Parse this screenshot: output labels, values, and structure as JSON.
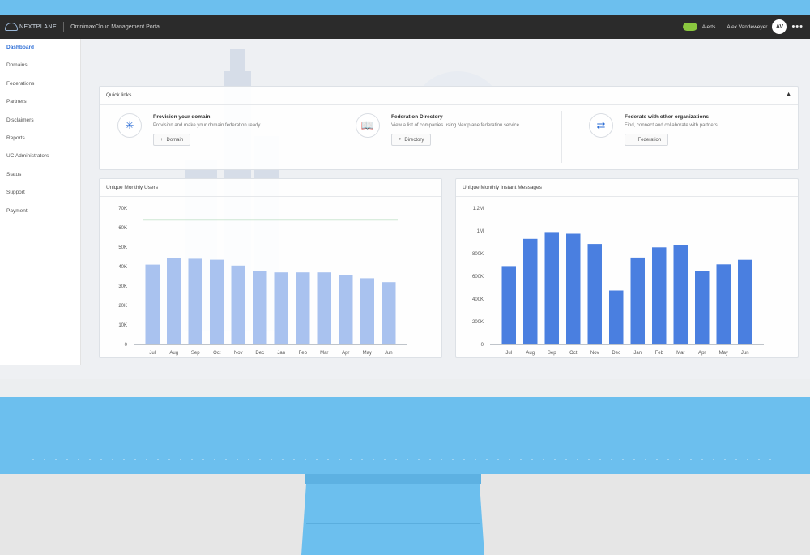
{
  "header": {
    "brand": "NEXTPLANE",
    "portal_title": "OmnimaxCloud Management Portal",
    "alerts_label": "Alerts",
    "user_name": "Alex Vandeweyer",
    "avatar_initials": "AV",
    "more_icon": "more-icon"
  },
  "sidebar": {
    "items": [
      {
        "label": "Dashboard",
        "active": true
      },
      {
        "label": "Domains"
      },
      {
        "label": "Federations"
      },
      {
        "label": "Partners"
      },
      {
        "label": "Disclaimers"
      },
      {
        "label": "Reports"
      },
      {
        "label": "UC Administrators"
      },
      {
        "label": "Status"
      },
      {
        "label": "Support"
      },
      {
        "label": "Payment"
      }
    ]
  },
  "quick_links": {
    "title": "Quick links",
    "items": [
      {
        "title": "Provision your domain",
        "desc": "Provision and make your domain federation ready.",
        "button": "Domain",
        "icon": "gear-cog-icon"
      },
      {
        "title": "Federation Directory",
        "desc": "View a list of companies using Nextplane federation service",
        "button": "Directory",
        "icon": "book-icon"
      },
      {
        "title": "Federate with other organizations",
        "desc": "Find, connect and collaborate with partners.",
        "button": "Federation",
        "icon": "swap-arrows-icon"
      }
    ]
  },
  "colors": {
    "accent": "#2f6fd6",
    "users_bar": "#a9c2ef",
    "msgs_bar": "#4a7fe0",
    "header_bg": "#2b2b2b",
    "alert_green": "#8ac73f"
  },
  "chart_data": [
    {
      "type": "bar",
      "title": "Unique Monthly Users",
      "categories": [
        "Jul",
        "Aug",
        "Sep",
        "Oct",
        "Nov",
        "Dec",
        "Jan",
        "Feb",
        "Mar",
        "Apr",
        "May",
        "Jun"
      ],
      "values": [
        41000,
        44500,
        44000,
        43500,
        40500,
        37500,
        37000,
        37000,
        37000,
        35500,
        34000,
        32000
      ],
      "yticks": [
        "0",
        "10K",
        "20K",
        "30K",
        "40K",
        "50K",
        "60K",
        "70K"
      ],
      "ylim": [
        0,
        70000
      ],
      "reference_line": 64000,
      "grid": false
    },
    {
      "type": "bar",
      "title": "Unique Monthly Instant Messages",
      "categories": [
        "Jul",
        "Aug",
        "Sep",
        "Oct",
        "Nov",
        "Dec",
        "Jan",
        "Feb",
        "Mar",
        "Apr",
        "May",
        "Jun"
      ],
      "values": [
        690000,
        930000,
        990000,
        975000,
        885000,
        475000,
        765000,
        855000,
        875000,
        650000,
        705000,
        745000
      ],
      "yticks": [
        "0",
        "200K",
        "400K",
        "600K",
        "800K",
        "1M",
        "1.2M"
      ],
      "ylim": [
        0,
        1200000
      ],
      "grid": false
    }
  ]
}
